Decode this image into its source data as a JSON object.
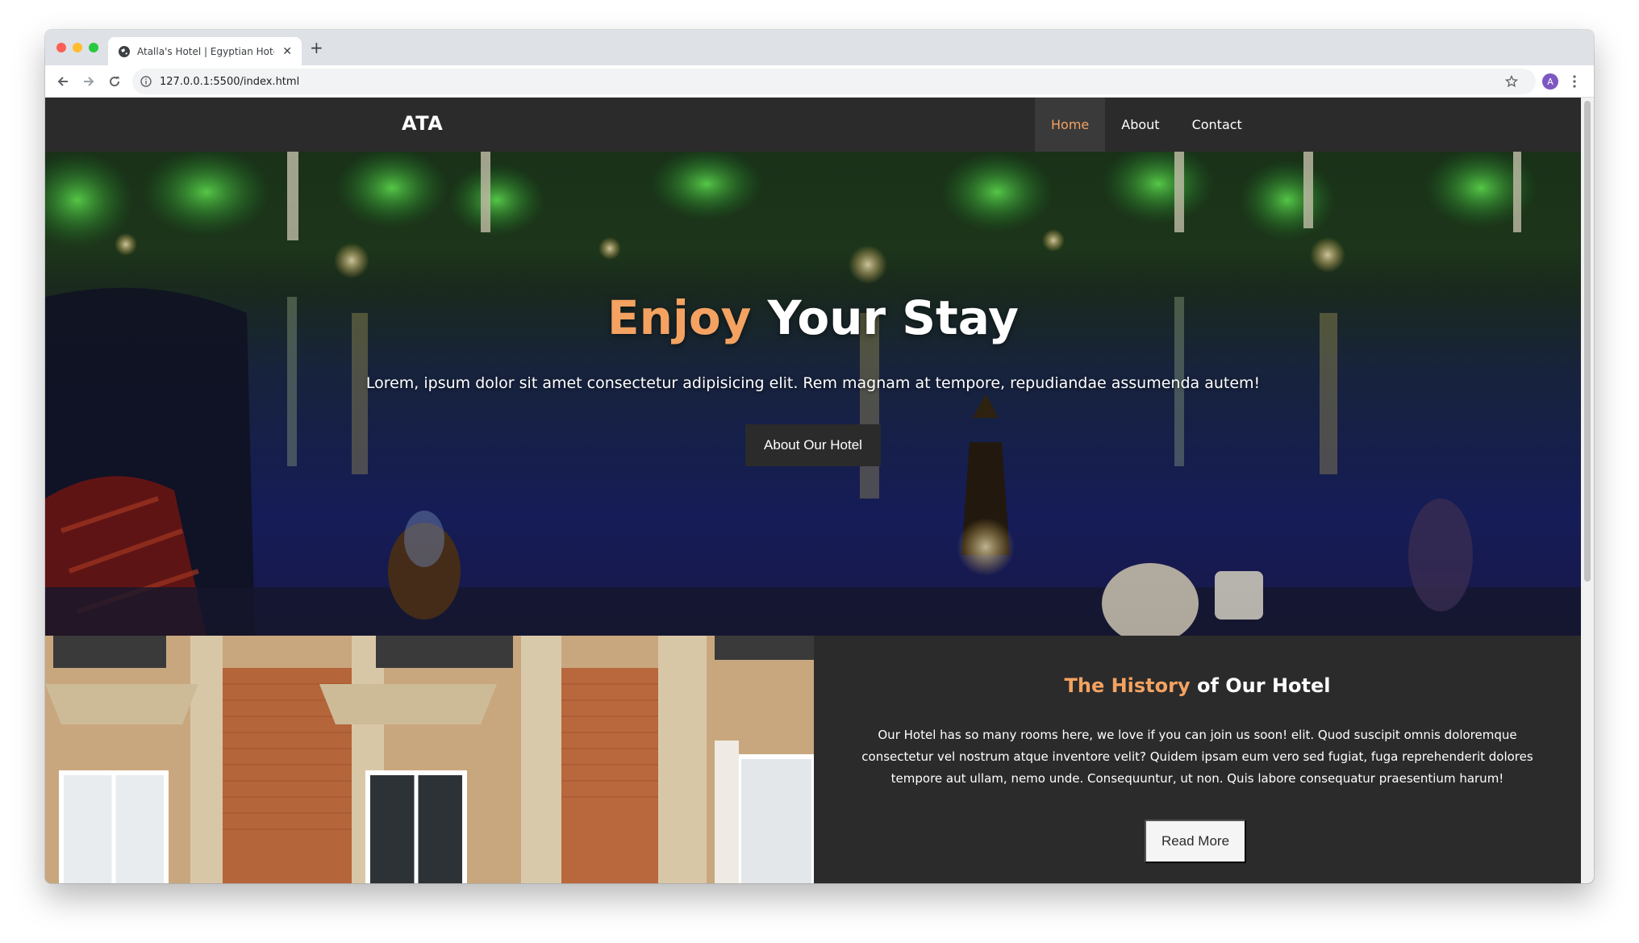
{
  "browser": {
    "tab_title": "Atalla's Hotel | Egyptian Hotel",
    "url": "127.0.0.1:5500/index.html",
    "profile_initial": "A"
  },
  "site": {
    "brand": "ATA",
    "nav": [
      {
        "label": "Home",
        "active": true
      },
      {
        "label": "About",
        "active": false
      },
      {
        "label": "Contact",
        "active": false
      }
    ]
  },
  "hero": {
    "title_accent": "Enjoy",
    "title_rest": " Your Stay",
    "text": "Lorem, ipsum dolor sit amet consectetur adipisicing elit. Rem magnam at tempore, repudiandae assumenda autem!",
    "button": "About Our Hotel"
  },
  "history": {
    "title_accent": "The History",
    "title_rest": " of Our Hotel",
    "text": "Our Hotel has so many rooms here, we love if you can join us soon! elit. Quod suscipit omnis doloremque consectetur vel nostrum atque inventore velit? Quidem ipsam eum vero sed fugiat, fuga reprehenderit dolores tempore aut ullam, nemo unde. Consequuntur, ut non. Quis labore consequatur praesentium harum!",
    "button": "Read More"
  },
  "colors": {
    "accent": "#f4a261",
    "dark": "#2b2b2b"
  }
}
